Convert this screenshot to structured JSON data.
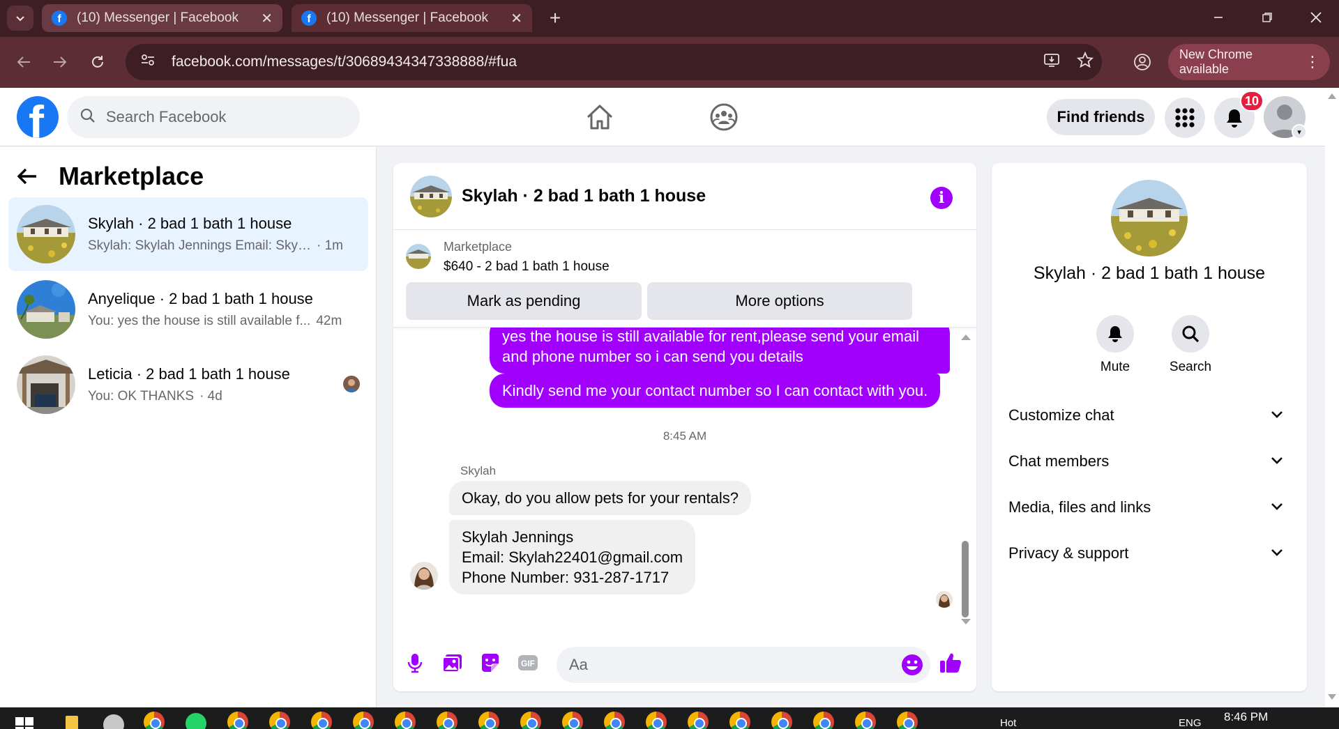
{
  "browser": {
    "tabs": [
      {
        "title": "(10) Messenger | Facebook",
        "active": false
      },
      {
        "title": "(10) Messenger | Facebook",
        "active": true
      }
    ],
    "url": "facebook.com/messages/t/30689434347338888/#fua",
    "new_chrome_label": "New Chrome available"
  },
  "fb_header": {
    "search_placeholder": "Search Facebook",
    "find_friends_label": "Find friends",
    "notification_count": "10"
  },
  "left_panel": {
    "title": "Marketplace",
    "conversations": [
      {
        "name": "Skylah · 2 bad 1 bath 1 house",
        "preview": "Skylah: Skylah Jennings Email: Skylah...",
        "time": "· 1m",
        "selected": true
      },
      {
        "name": "Anyelique · 2 bad 1 bath 1 house",
        "preview": "You: yes the house is still available f...",
        "time": "42m",
        "selected": false
      },
      {
        "name": "Leticia · 2 bad 1 bath 1 house",
        "preview": "You: OK THANKS",
        "time": "· 4d",
        "selected": false
      }
    ]
  },
  "chat": {
    "title": "Skylah · 2 bad 1 bath 1 house",
    "marketplace_label": "Marketplace",
    "listing": "$640 - 2 bad 1 bath 1 house",
    "mark_pending_label": "Mark as pending",
    "more_options_label": "More options",
    "outgoing": [
      {
        "line1": "yes the house is still available for rent,please send your email",
        "line2": "and phone number so i can send you details"
      },
      {
        "text": "Kindly send me your contact number so I can contact with you."
      }
    ],
    "timestamp": "8:45 AM",
    "sender": "Skylah",
    "incoming": [
      {
        "text": "Okay, do you allow pets for your rentals?"
      },
      {
        "line1": "Skylah Jennings",
        "line2": "Email: Skylah22401@gmail.com",
        "line3": "Phone Number: 931-287-1717"
      }
    ],
    "composer_placeholder": "Aa"
  },
  "right_panel": {
    "name": "Skylah · 2 bad 1 bath 1 house",
    "mute_label": "Mute",
    "search_label": "Search",
    "sections": [
      "Customize chat",
      "Chat members",
      "Media, files and links",
      "Privacy & support"
    ]
  },
  "taskbar": {
    "time": "8:46 PM",
    "lang": "ENG",
    "weather": "Hot"
  },
  "colors": {
    "messenger_purple": "#a100ff",
    "fb_blue": "#1877f2",
    "chrome_frame": "#5d2d36"
  }
}
